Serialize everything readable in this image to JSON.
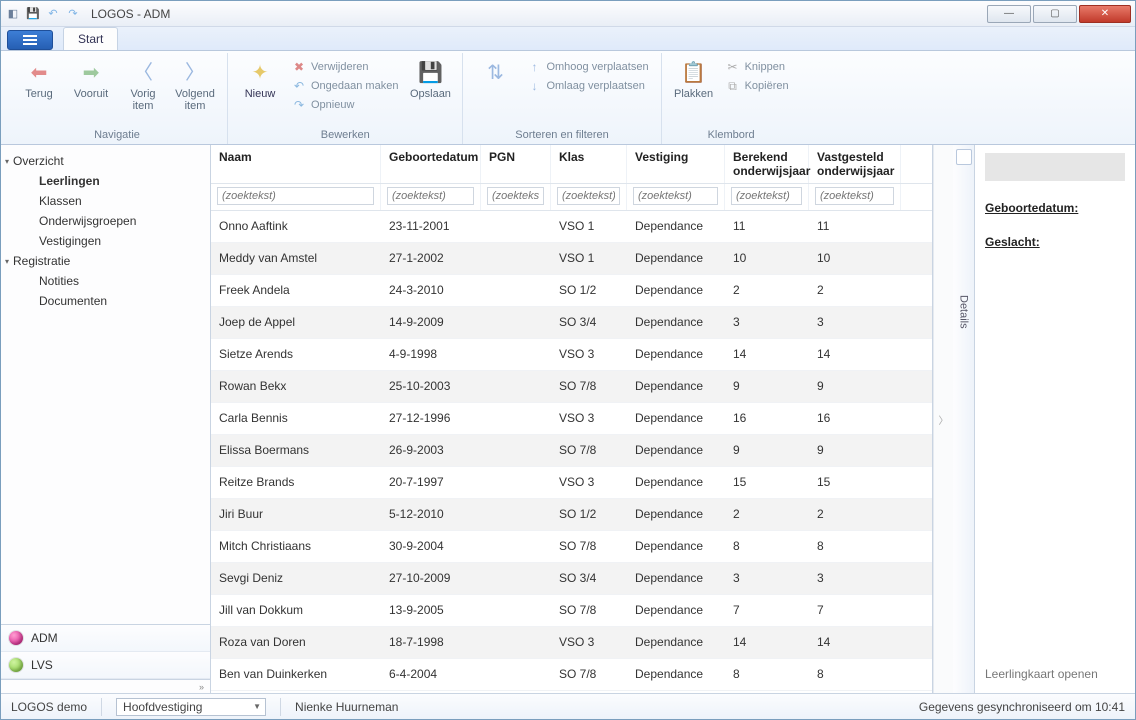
{
  "app_title": "LOGOS - ADM",
  "ribbon": {
    "tab_start": "Start",
    "nav": {
      "terug": "Terug",
      "vooruit": "Vooruit",
      "vorig": "Vorig item",
      "volgend": "Volgend item",
      "group": "Navigatie"
    },
    "edit": {
      "nieuw": "Nieuw",
      "verwijderen": "Verwijderen",
      "ongedaan": "Ongedaan maken",
      "opnieuw": "Opnieuw",
      "opslaan": "Opslaan",
      "group": "Bewerken"
    },
    "sort": {
      "omhoog": "Omhoog verplaatsen",
      "omlaag": "Omlaag verplaatsen",
      "group": "Sorteren en filteren"
    },
    "clip": {
      "plakken": "Plakken",
      "knippen": "Knippen",
      "kopieren": "Kopiëren",
      "group": "Klembord"
    }
  },
  "nav": {
    "overzicht": "Overzicht",
    "leerlingen": "Leerlingen",
    "klassen": "Klassen",
    "onderwijsgroepen": "Onderwijsgroepen",
    "vestigingen": "Vestigingen",
    "registratie": "Registratie",
    "notities": "Notities",
    "documenten": "Documenten",
    "mod_adm": "ADM",
    "mod_lvs": "LVS"
  },
  "grid": {
    "headers": {
      "naam": "Naam",
      "geboorte": "Geboortedatum",
      "pgn": "PGN",
      "klas": "Klas",
      "vestiging": "Vestiging",
      "berekend": "Berekend onderwijsjaar",
      "vastgesteld": "Vastgesteld onderwijsjaar"
    },
    "filter_placeholder": "(zoektekst)",
    "rows": [
      {
        "naam": "Onno Aaftink",
        "geb": "23-11-2001",
        "pgn": "",
        "klas": "VSO 1",
        "vest": "Dependance",
        "ber": "11",
        "vast": "11"
      },
      {
        "naam": "Meddy van Amstel",
        "geb": "27-1-2002",
        "pgn": "",
        "klas": "VSO 1",
        "vest": "Dependance",
        "ber": "10",
        "vast": "10"
      },
      {
        "naam": "Freek Andela",
        "geb": "24-3-2010",
        "pgn": "",
        "klas": "SO 1/2",
        "vest": "Dependance",
        "ber": "2",
        "vast": "2"
      },
      {
        "naam": "Joep de Appel",
        "geb": "14-9-2009",
        "pgn": "",
        "klas": "SO 3/4",
        "vest": "Dependance",
        "ber": "3",
        "vast": "3"
      },
      {
        "naam": "Sietze Arends",
        "geb": "4-9-1998",
        "pgn": "",
        "klas": "VSO 3",
        "vest": "Dependance",
        "ber": "14",
        "vast": "14"
      },
      {
        "naam": "Rowan Bekx",
        "geb": "25-10-2003",
        "pgn": "",
        "klas": "SO 7/8",
        "vest": "Dependance",
        "ber": "9",
        "vast": "9"
      },
      {
        "naam": "Carla Bennis",
        "geb": "27-12-1996",
        "pgn": "",
        "klas": "VSO 3",
        "vest": "Dependance",
        "ber": "16",
        "vast": "16"
      },
      {
        "naam": "Elissa Boermans",
        "geb": "26-9-2003",
        "pgn": "",
        "klas": "SO 7/8",
        "vest": "Dependance",
        "ber": "9",
        "vast": "9"
      },
      {
        "naam": "Reitze Brands",
        "geb": "20-7-1997",
        "pgn": "",
        "klas": "VSO 3",
        "vest": "Dependance",
        "ber": "15",
        "vast": "15"
      },
      {
        "naam": "Jiri Buur",
        "geb": "5-12-2010",
        "pgn": "",
        "klas": "SO 1/2",
        "vest": "Dependance",
        "ber": "2",
        "vast": "2"
      },
      {
        "naam": "Mitch Christiaans",
        "geb": "30-9-2004",
        "pgn": "",
        "klas": "SO 7/8",
        "vest": "Dependance",
        "ber": "8",
        "vast": "8"
      },
      {
        "naam": "Sevgi Deniz",
        "geb": "27-10-2009",
        "pgn": "",
        "klas": "SO 3/4",
        "vest": "Dependance",
        "ber": "3",
        "vast": "3"
      },
      {
        "naam": "Jill van Dokkum",
        "geb": "13-9-2005",
        "pgn": "",
        "klas": "SO 7/8",
        "vest": "Dependance",
        "ber": "7",
        "vast": "7"
      },
      {
        "naam": "Roza van Doren",
        "geb": "18-7-1998",
        "pgn": "",
        "klas": "VSO 3",
        "vest": "Dependance",
        "ber": "14",
        "vast": "14"
      },
      {
        "naam": "Ben van Duinkerken",
        "geb": "6-4-2004",
        "pgn": "",
        "klas": "SO 7/8",
        "vest": "Dependance",
        "ber": "8",
        "vast": "8"
      }
    ]
  },
  "details_tab": "Details",
  "info": {
    "geboortedatum": "Geboortedatum:",
    "geslacht": "Geslacht:",
    "link": "Leerlingkaart openen"
  },
  "status": {
    "demo": "LOGOS demo",
    "vestiging": "Hoofdvestiging",
    "user": "Nienke Huurneman",
    "sync": "Gegevens gesynchroniseerd om 10:41"
  }
}
